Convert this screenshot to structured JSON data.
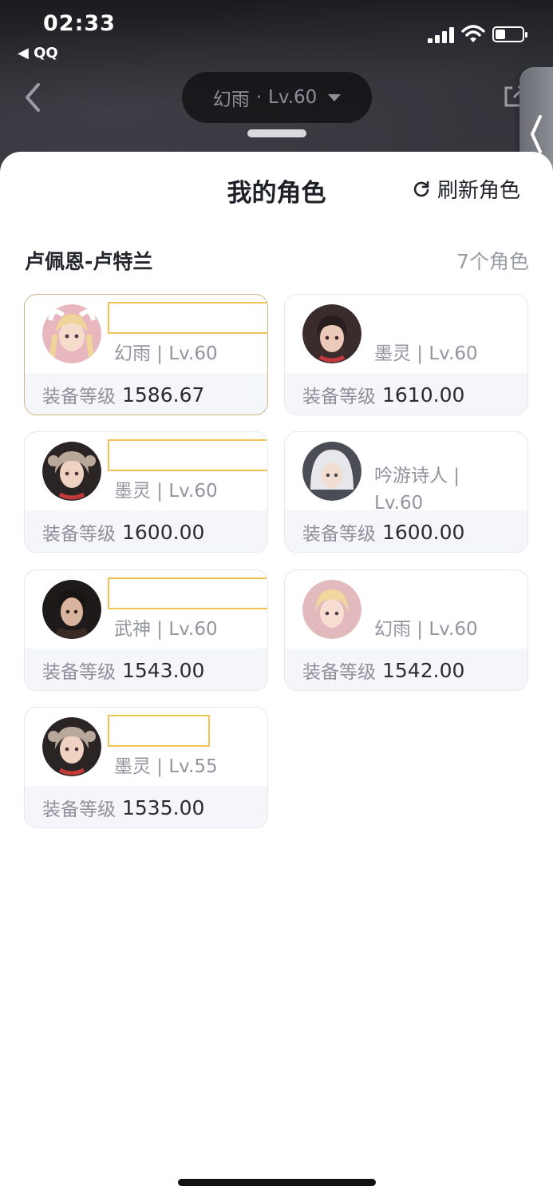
{
  "status_bar": {
    "time": "02:33",
    "back_app": "◀ QQ"
  },
  "nav": {
    "character_name": "幻雨",
    "separator": "·",
    "level": "Lv.60"
  },
  "sheet": {
    "title": "我的角色",
    "refresh_label": "刷新角色",
    "server_name": "卢佩恩-卢特兰",
    "role_count": "7个角色",
    "gear_label": "装备等级"
  },
  "characters": [
    {
      "cls": "幻雨 | Lv.60",
      "gear": "1586.67",
      "selected": true,
      "avatar": "pink-hair-girl"
    },
    {
      "cls": "墨灵 | Lv.60",
      "gear": "1610.00",
      "selected": false,
      "avatar": "dark-hair-girl"
    },
    {
      "cls": "墨灵 | Lv.60",
      "gear": "1600.00",
      "selected": false,
      "avatar": "grey-hair-girl"
    },
    {
      "cls": "吟游诗人 | Lv.60",
      "gear": "1600.00",
      "selected": false,
      "avatar": "white-hood-girl"
    },
    {
      "cls": "武神 | Lv.60",
      "gear": "1543.00",
      "selected": false,
      "avatar": "dark-hair-man"
    },
    {
      "cls": "幻雨 | Lv.60",
      "gear": "1542.00",
      "selected": false,
      "avatar": "blonde-girl"
    },
    {
      "cls": "墨灵 | Lv.55",
      "gear": "1535.00",
      "selected": false,
      "avatar": "grey-hair-girl"
    }
  ]
}
